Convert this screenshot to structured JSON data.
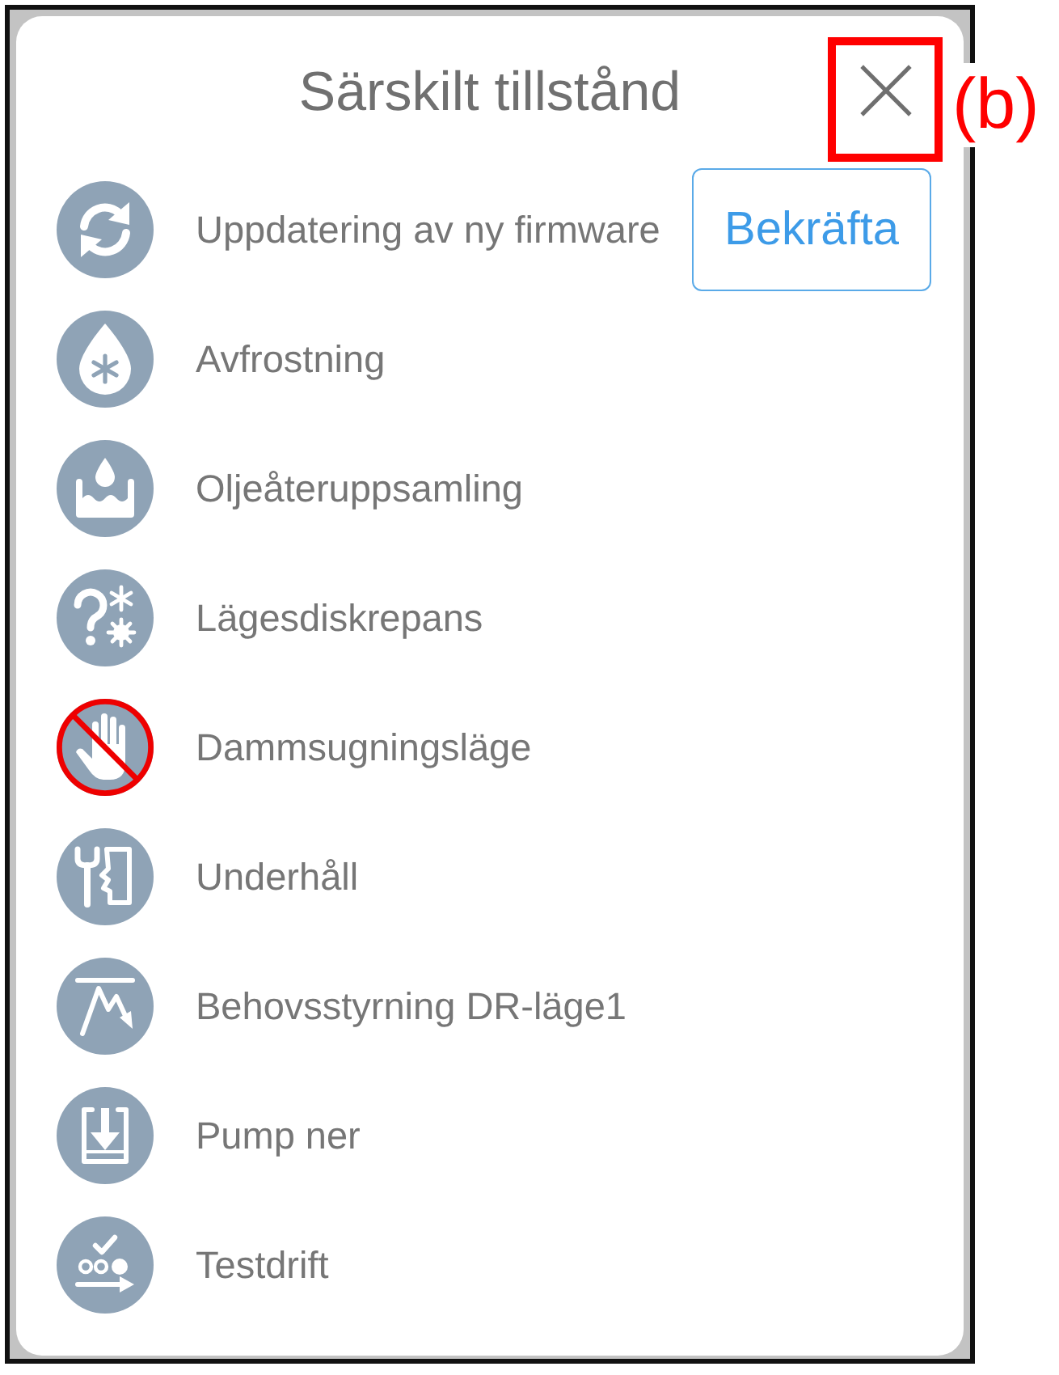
{
  "dialog": {
    "title": "Särskilt tillstånd",
    "items": [
      {
        "label": "Uppdatering av ny firmware",
        "blocked": false,
        "action": "Bekräfta"
      },
      {
        "label": "Avfrostning",
        "blocked": false
      },
      {
        "label": "Oljeåteruppsamling",
        "blocked": false
      },
      {
        "label": "Lägesdiskrepans",
        "blocked": false
      },
      {
        "label": "Dammsugningsläge",
        "blocked": true
      },
      {
        "label": "Underhåll",
        "blocked": false
      },
      {
        "label": "Behovsstyrning DR-läge1",
        "blocked": false
      },
      {
        "label": "Pump ner",
        "blocked": false
      },
      {
        "label": "Testdrift",
        "blocked": false
      }
    ]
  },
  "annotation": {
    "label": "(b)"
  }
}
